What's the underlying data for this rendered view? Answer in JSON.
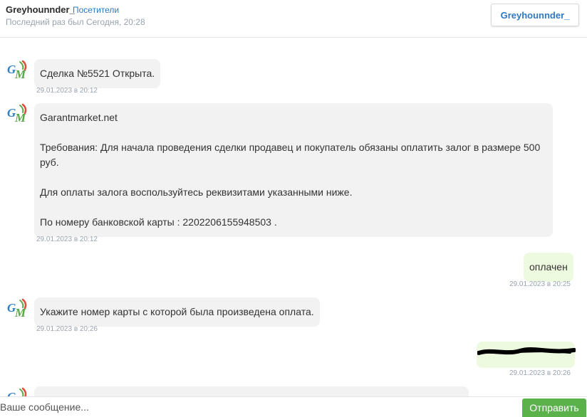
{
  "header": {
    "username": "Greyhounnder_",
    "role_tag": "Посетители",
    "last_seen": "Последний раз был Сегодня, 20:28",
    "profile_button": "Greyhounnder_"
  },
  "messages": [
    {
      "from": "garant",
      "lines": [
        "Сделка №5521 Открыта."
      ],
      "time": "29.01.2023 в 20:12"
    },
    {
      "from": "garant",
      "lines": [
        "Garantmarket.net",
        "",
        "Требования: Для начала проведения сделки продавец и покупатель обязаны оплатить залог в размере 500",
        "руб.",
        "",
        "Для оплаты залога воспользуйтесь реквизитами указанными ниже.",
        "",
        "По номеру банковской карты : 2202206155948503 ."
      ],
      "time": "29.01.2023 в 20:12"
    },
    {
      "from": "user",
      "lines": [
        "оплачен"
      ],
      "time": "29.01.2023 в 20:25"
    },
    {
      "from": "garant",
      "lines": [
        "Укажите номер карты с которой была произведена оплата."
      ],
      "time": "29.01.2023 в 20:26"
    },
    {
      "from": "user",
      "lines": [],
      "redacted": true,
      "time": "29.01.2023 в 20:26"
    }
  ],
  "avatar_logo": {
    "letters": "GM",
    "colors": {
      "g": "#2e7fc4",
      "m": "#58a846",
      "accent": "#e04b3a"
    }
  },
  "composer": {
    "placeholder": "Ваше сообщение...",
    "send_label": "Отправить"
  },
  "colors": {
    "accent": "#2f78c4",
    "send": "#5bb24a",
    "incoming_bubble": "#f2f2f2",
    "outgoing_bubble": "#eefae0"
  }
}
